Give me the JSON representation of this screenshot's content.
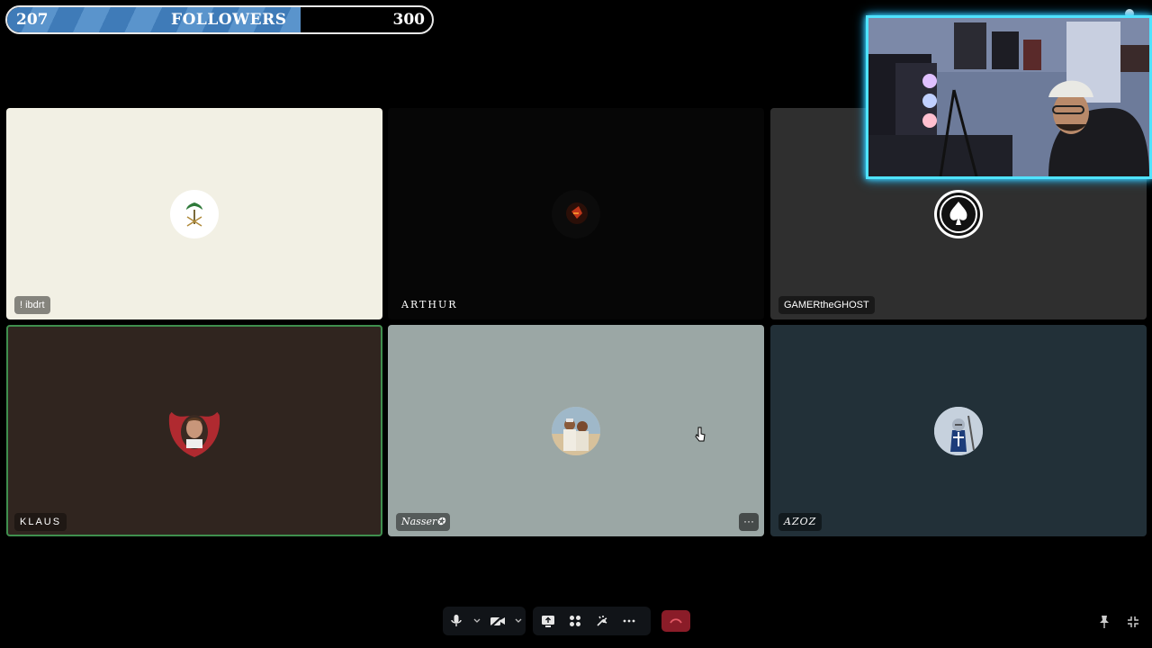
{
  "goal": {
    "current": "207",
    "label": "FOLLOWERS",
    "target": "300",
    "progress": 0.69
  },
  "participants": [
    {
      "name": "! ibdrt",
      "background": "#f2f0e4",
      "avatar": "emblem-avatar"
    },
    {
      "name": "ARTHUR",
      "background": "#060606",
      "avatar": "dark-figure-avatar"
    },
    {
      "name": "GAMERtheGHOST",
      "background": "#2f2f2f",
      "avatar": "spade-logo-avatar"
    },
    {
      "name": "KLAUS",
      "background": "#30251f",
      "avatar": "portrait-wings-avatar",
      "active": true
    },
    {
      "name": "Nasser✪",
      "background": "#9ba7a5",
      "avatar": "group-photo-avatar"
    },
    {
      "name": "AZOZ",
      "background": "#223038",
      "avatar": "knight-avatar"
    }
  ],
  "tile_menu_label": "···",
  "toolbar": {
    "icons": [
      "microphone-icon",
      "chevron-down-icon",
      "camera-off-icon",
      "chevron-down-icon",
      "share-screen-icon",
      "activities-icon",
      "effects-icon",
      "more-icon",
      "hang-up-icon",
      "pin-icon",
      "exit-fullscreen-icon"
    ]
  },
  "colors": {
    "accent_webcam": "#4fe3ff",
    "active_border": "#3f8f4e",
    "hangup": "#8a1c28",
    "goal_fill": "#4a87c2"
  }
}
